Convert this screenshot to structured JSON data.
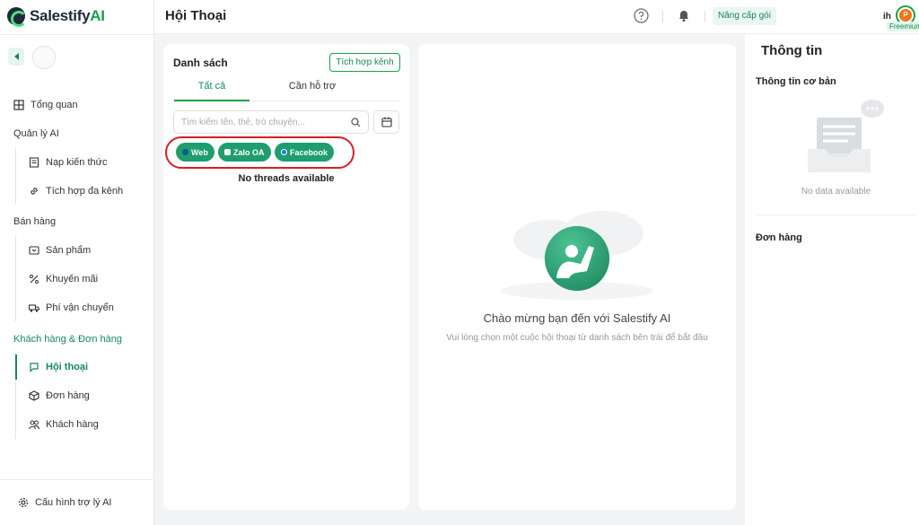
{
  "app": {
    "logo_text": "Salestify",
    "logo_suffix": "AI"
  },
  "header": {
    "page_title": "Hội Thoại",
    "upgrade_label": "Nâng cấp gói",
    "user_name_fragment": "ih",
    "avatar_letter": "P",
    "plan_badge": "Freemium"
  },
  "sidebar": {
    "overview": "Tổng quan",
    "section_ai": "Quản lý AI",
    "knowledge": "Nạp kiến thức",
    "channels": "Tích hợp đa kênh",
    "section_sales": "Bán hàng",
    "products": "Sản phẩm",
    "promotions": "Khuyến mãi",
    "shipping": "Phí vận chuyển",
    "section_customers": "Khách hàng & Đơn hàng",
    "conversations": "Hội thoại",
    "orders": "Đơn hàng",
    "customers": "Khách hàng",
    "assistant_config": "Cấu hình trợ lý AI"
  },
  "list": {
    "title": "Danh sách",
    "integrate_button": "Tích hợp kênh",
    "tabs": [
      {
        "label": "Tất cả",
        "active": true
      },
      {
        "label": "Cần hỗ trợ",
        "active": false
      }
    ],
    "search_placeholder": "Tìm kiếm tên, thẻ, trò chuyện...",
    "channel_filters": [
      {
        "label": "Web",
        "icon": "globe-icon"
      },
      {
        "label": "Zalo OA",
        "icon": "zalo-icon"
      },
      {
        "label": "Facebook",
        "icon": "facebook-icon"
      }
    ],
    "empty_text": "No threads available"
  },
  "chat": {
    "welcome_title": "Chào mừng bạn đến với Salestify AI",
    "welcome_subtitle": "Vui lòng chọn một cuộc hội thoại từ danh sách bên trái để bắt đầu"
  },
  "info": {
    "title": "Thông tin",
    "basic_info": "Thông tin cơ bản",
    "no_data": "No data available",
    "orders": "Đơn hàng"
  },
  "colors": {
    "brand_green": "#16a34a",
    "accent_dark_green": "#16875a",
    "chip_green": "#1f9d6e",
    "highlight_red": "#d81f26",
    "avatar_orange": "#f97316"
  }
}
